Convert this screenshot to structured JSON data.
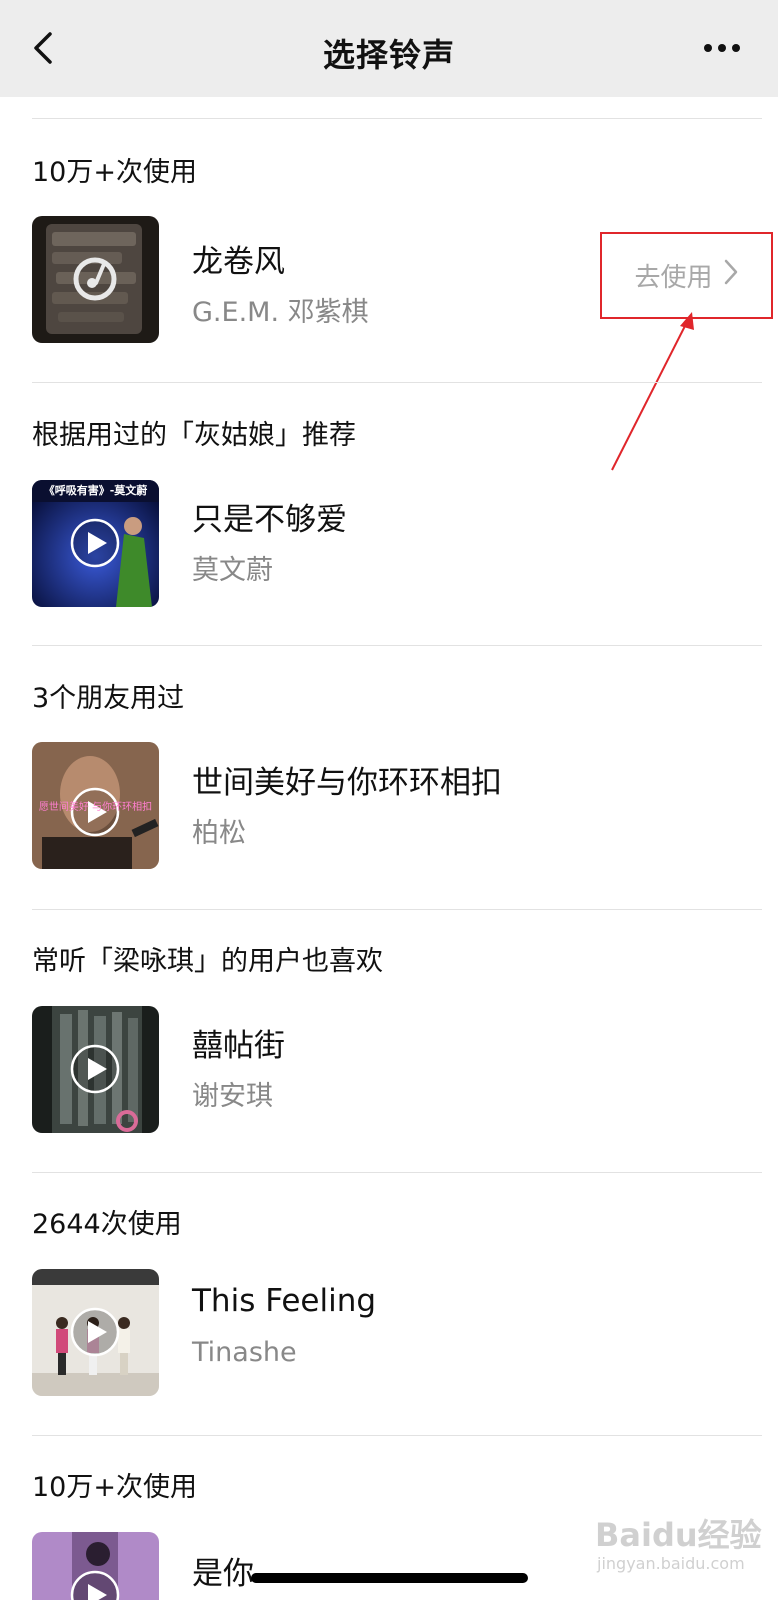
{
  "header": {
    "title": "选择铃声"
  },
  "sections": [
    {
      "title": "10万+次使用",
      "song": {
        "title": "龙卷风",
        "artist": "G.E.M. 邓紫棋"
      },
      "action_label": "去使用"
    },
    {
      "title": "根据用过的「灰姑娘」推荐",
      "song": {
        "title": "只是不够爱",
        "artist": "莫文蔚"
      },
      "thumb_caption": "《呼吸有害》-莫文蔚"
    },
    {
      "title": "3个朋友用过",
      "song": {
        "title": "世间美好与你环环相扣",
        "artist": "柏松"
      },
      "thumb_caption": "愿世间美好 与你环环相扣"
    },
    {
      "title": "常听「梁咏琪」的用户也喜欢",
      "song": {
        "title": "囍帖街",
        "artist": "谢安琪"
      }
    },
    {
      "title": "2644次使用",
      "song": {
        "title": "This Feeling",
        "artist": "Tinashe"
      }
    },
    {
      "title": "10万+次使用",
      "song": {
        "title": "是你",
        "artist": ""
      }
    }
  ],
  "watermark": {
    "brand": "Baidu经验",
    "url": "jingyan.baidu.com"
  },
  "colors": {
    "nav_background": "#ededed",
    "annotation_red": "#e0262b",
    "secondary_text": "#888888"
  },
  "icons": [
    "back-icon",
    "more-icon",
    "chevron-right-icon",
    "play-icon",
    "music-note-icon"
  ]
}
